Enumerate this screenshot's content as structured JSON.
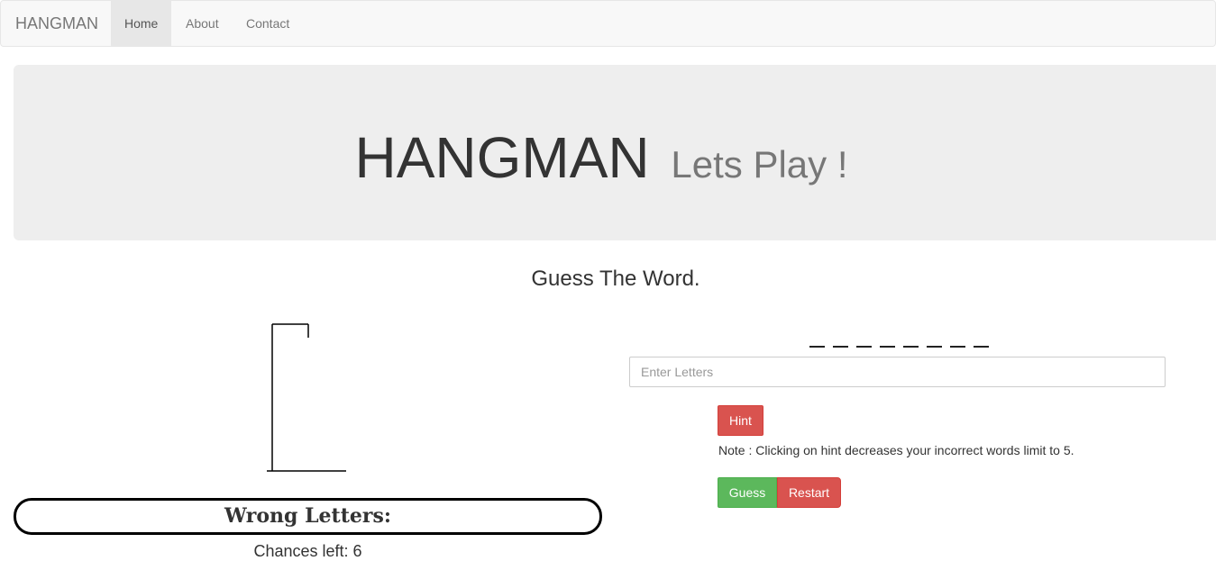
{
  "navbar": {
    "brand": "HANGMAN",
    "items": [
      {
        "label": "Home"
      },
      {
        "label": "About"
      },
      {
        "label": "Contact"
      }
    ]
  },
  "jumbotron": {
    "title": "HANGMAN",
    "subtitle": "Lets Play !"
  },
  "game": {
    "heading": "Guess The Word.",
    "blank_count": 8,
    "input_placeholder": "Enter Letters",
    "hint_label": "Hint",
    "note": "Note : Clicking on hint decreases your incorrect words limit to 5.",
    "guess_label": "Guess",
    "restart_label": "Restart",
    "wrong_letters_label": "Wrong Letters:",
    "chances_text": "Chances left: 6"
  },
  "colors": {
    "danger": "#d9534f",
    "success": "#5cb85c",
    "jumbotron_bg": "#eeeeee",
    "navbar_bg": "#f8f8f8"
  }
}
